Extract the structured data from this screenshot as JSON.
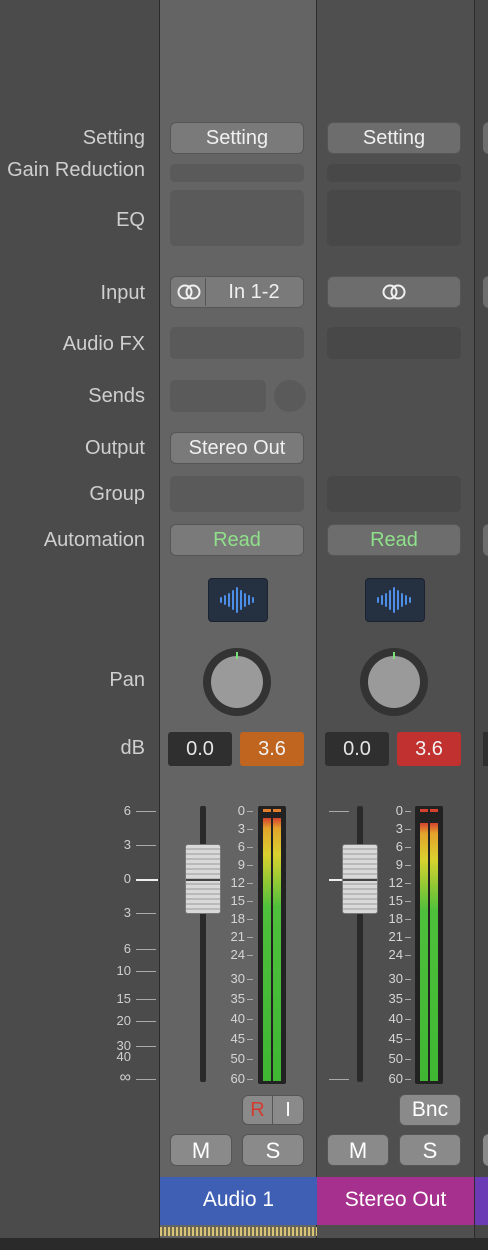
{
  "row_labels": {
    "setting": "Setting",
    "gain_reduction": "Gain Reduction",
    "eq": "EQ",
    "input": "Input",
    "audio_fx": "Audio FX",
    "sends": "Sends",
    "output": "Output",
    "group": "Group",
    "automation": "Automation",
    "pan": "Pan",
    "db": "dB"
  },
  "scale_left": [
    "6",
    "3",
    "0",
    "3",
    "6",
    "10",
    "15",
    "20",
    "30",
    "40",
    "∞"
  ],
  "meter_scale": [
    "0",
    "3",
    "6",
    "9",
    "12",
    "15",
    "18",
    "21",
    "24",
    "30",
    "35",
    "40",
    "45",
    "50",
    "60"
  ],
  "strip1": {
    "setting": "Setting",
    "input": "In 1-2",
    "output": "Stereo Out",
    "automation": "Read",
    "volume_db": "0.0",
    "peak_db": "3.6",
    "r_label": "R",
    "i_label": "I",
    "mute": "M",
    "solo": "S",
    "name": "Audio 1",
    "color": "#3f5fb5"
  },
  "strip2": {
    "setting": "Setting",
    "automation": "Read",
    "volume_db": "0.0",
    "peak_db": "3.6",
    "bounce": "Bnc",
    "mute": "M",
    "solo": "S",
    "name": "Stereo Out",
    "color": "#a6308e"
  }
}
